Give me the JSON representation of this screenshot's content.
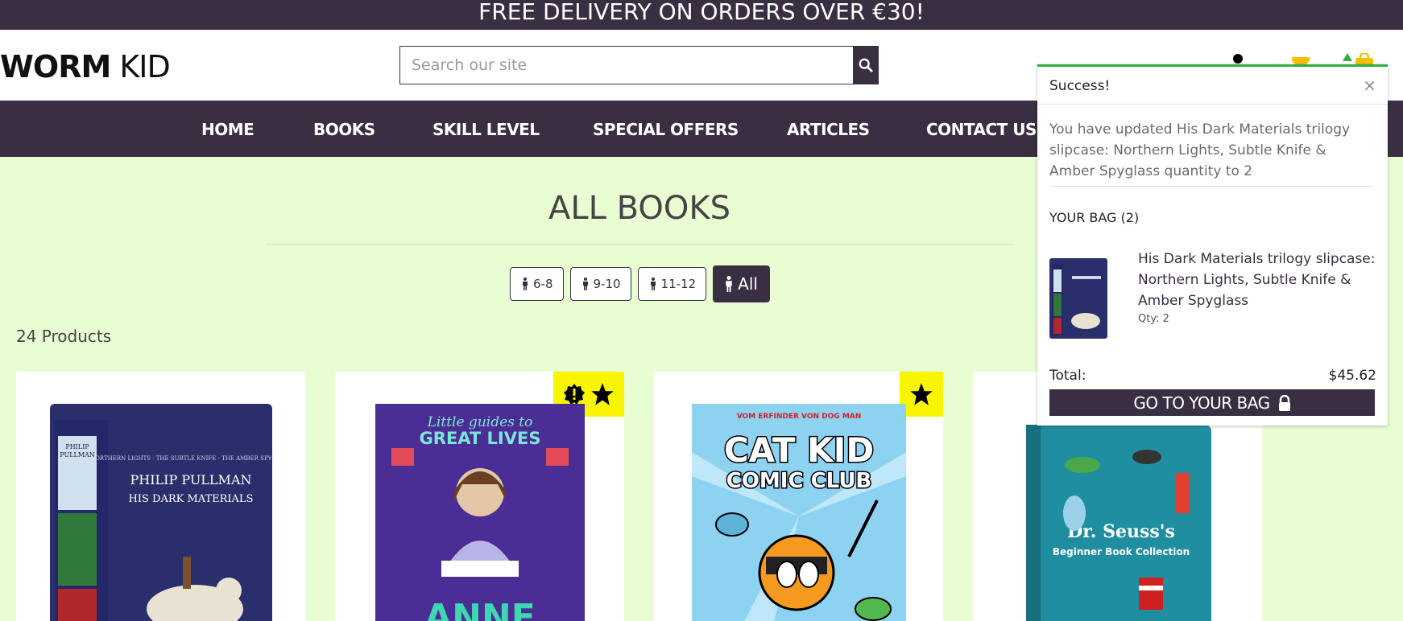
{
  "banner": {
    "text": "FREE DELIVERY ON ORDERS OVER €30!"
  },
  "header": {
    "logo_bold": "WORM",
    "logo_light": " KID",
    "search_placeholder": "Search our site",
    "icons": [
      "search-icon",
      "account-icon",
      "heart-icon",
      "bag-icon"
    ]
  },
  "nav": {
    "items": [
      {
        "label": "HOME"
      },
      {
        "label": "BOOKS"
      },
      {
        "label": "SKILL LEVEL"
      },
      {
        "label": "SPECIAL OFFERS"
      },
      {
        "label": "ARTICLES"
      },
      {
        "label": "CONTACT US"
      }
    ]
  },
  "main": {
    "title": "ALL BOOKS",
    "filters": [
      {
        "label": "6-8",
        "active": false
      },
      {
        "label": "9-10",
        "active": false
      },
      {
        "label": "11-12",
        "active": false
      },
      {
        "label": "All",
        "active": true
      }
    ],
    "product_count": "24 Products",
    "products": [
      {
        "cover": "His Dark Materials slipcase",
        "badges": []
      },
      {
        "cover": "Little guides to Great Lives: Anne",
        "badges": [
          "alert-badge-icon",
          "star-icon"
        ]
      },
      {
        "cover": "Cat Kid Comic Club",
        "badges": [
          "star-icon"
        ]
      },
      {
        "cover": "Dr. Seuss's Beginner Book Collection",
        "badges": []
      }
    ],
    "cover_text": {
      "pullman_name": "PHILIP PULLMAN",
      "pullman_series": "HIS DARK MATERIALS",
      "pullman_header": "NORTHERN LIGHTS · THE SUBTLE KNIFE · THE AMBER SPYGLASS",
      "anne_top1": "Little guides to",
      "anne_top2": "GREAT LIVES",
      "anne_name": "ANNE",
      "catkid_top": "VOM ERFINDER VON DOG MAN",
      "catkid_title1": "CAT KID",
      "catkid_title2": "COMIC CLUB",
      "seuss_title1": "Dr. Seuss's",
      "seuss_title2": "Beginner Book Collection"
    }
  },
  "toast": {
    "title": "Success!",
    "close": "×",
    "message": "You have updated His Dark Materials trilogy slipcase: Northern Lights, Subtle Knife & Amber Spyglass quantity to 2",
    "bag_heading": "YOUR BAG (2)",
    "item_title": "His Dark Materials trilogy slipcase: Northern Lights, Subtle Knife & Amber Spyglass",
    "item_qty": "Qty: 2",
    "total_label": "Total:",
    "total_value": "$45.62",
    "button_label": "GO TO YOUR BAG"
  },
  "colors": {
    "brand": "#3a2e42",
    "background": "#e9fdd3",
    "badge": "#f9f500",
    "success": "#2fae45"
  }
}
